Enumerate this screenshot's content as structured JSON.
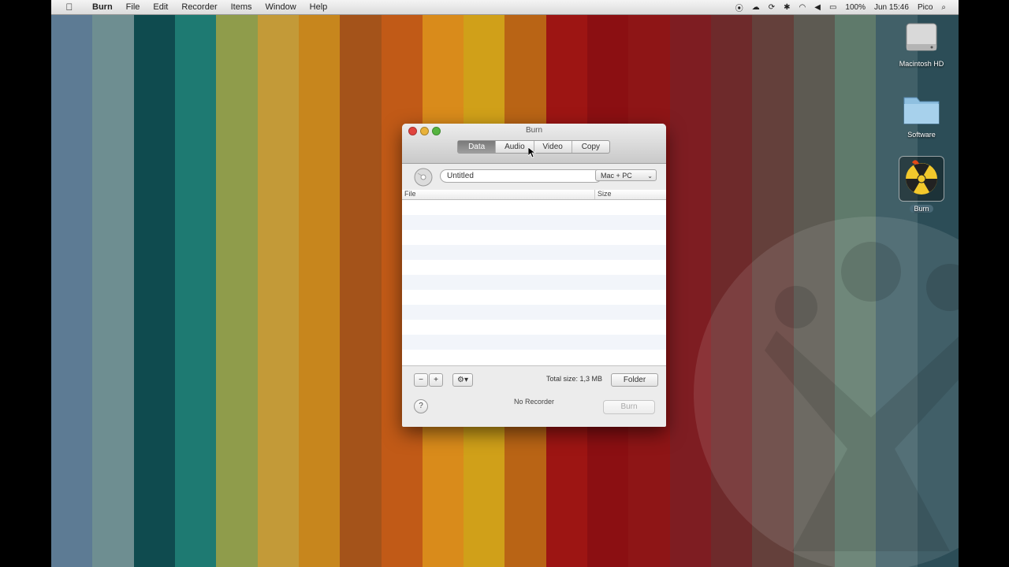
{
  "menubar": {
    "app_name": "Burn",
    "items": [
      "File",
      "Edit",
      "Recorder",
      "Items",
      "Window",
      "Help"
    ],
    "battery": "100%",
    "clock": "Jun 15:46",
    "user": "Pico"
  },
  "desktop": {
    "icons": [
      {
        "label": "Macintosh HD",
        "icon": "hard-drive-icon"
      },
      {
        "label": "Software",
        "icon": "folder-icon"
      },
      {
        "label": "Burn",
        "icon": "burn-app-icon"
      }
    ],
    "stripe_colors": [
      "#5d7b94",
      "#6e8e91",
      "#0f4b4f",
      "#1e7a72",
      "#8f9c4b",
      "#c39a38",
      "#c7861d",
      "#a4531a",
      "#c15a17",
      "#d98b1b",
      "#d0a019",
      "#b96415",
      "#9d1513",
      "#8b0f12",
      "#8e1516",
      "#7e1d22",
      "#6e2a2b",
      "#64403b",
      "#5d5a52",
      "#5f7a6b",
      "#416068",
      "#2c4d57"
    ]
  },
  "window": {
    "title": "Burn",
    "tabs": [
      "Data",
      "Audio",
      "Video",
      "Copy"
    ],
    "active_tab": "Data",
    "disc_name": "Untitled",
    "format": "Mac + PC",
    "columns": [
      "File",
      "Size"
    ],
    "total_size_label": "Total size:",
    "total_size_value": "1,3 MB",
    "folder_button": "Folder",
    "status": "No Recorder",
    "burn_button": "Burn",
    "help_label": "?",
    "remove_label": "−",
    "add_label": "+",
    "action_label": "⚙▾"
  }
}
